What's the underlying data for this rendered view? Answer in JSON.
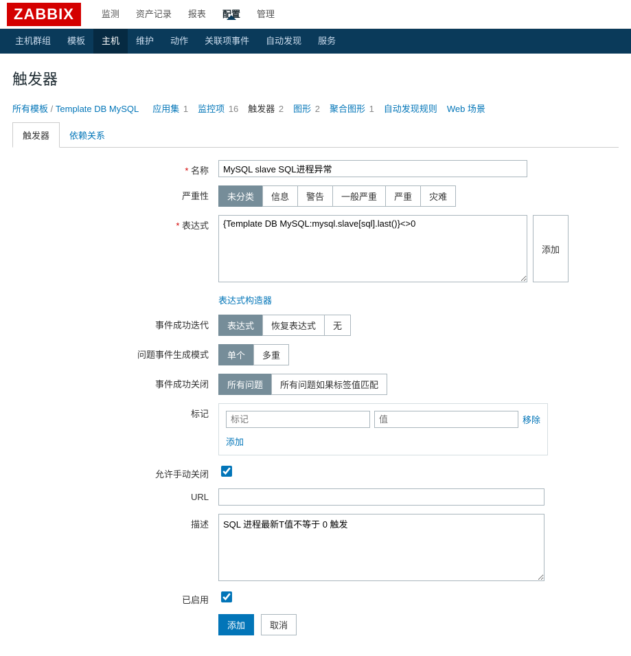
{
  "logo": "ZABBIX",
  "topnav": {
    "items": [
      {
        "label": "监测"
      },
      {
        "label": "资产记录"
      },
      {
        "label": "报表"
      },
      {
        "label": "配置"
      },
      {
        "label": "管理"
      }
    ],
    "activeIndex": 3
  },
  "subnav": {
    "items": [
      {
        "label": "主机群组"
      },
      {
        "label": "模板"
      },
      {
        "label": "主机"
      },
      {
        "label": "维护"
      },
      {
        "label": "动作"
      },
      {
        "label": "关联项事件"
      },
      {
        "label": "自动发现"
      },
      {
        "label": "服务"
      }
    ],
    "activeIndex": 2
  },
  "page_title": "触发器",
  "breadcrumb": {
    "root": "所有模板",
    "template": "Template DB MySQL",
    "tabs": [
      {
        "label": "应用集",
        "count": "1"
      },
      {
        "label": "监控项",
        "count": "16"
      },
      {
        "label": "触发器",
        "count": "2"
      },
      {
        "label": "图形",
        "count": "2"
      },
      {
        "label": "聚合图形",
        "count": "1"
      },
      {
        "label": "自动发现规则",
        "count": ""
      },
      {
        "label": "Web 场景",
        "count": ""
      }
    ],
    "activeIndex": 2
  },
  "formTabs": {
    "items": [
      {
        "label": "触发器"
      },
      {
        "label": "依赖关系"
      }
    ],
    "activeIndex": 0
  },
  "labels": {
    "name": "名称",
    "severity": "严重性",
    "expression": "表达式",
    "exprBuilder": "表达式构造器",
    "eventOkGen": "事件成功迭代",
    "problemEvtGen": "问题事件生成模式",
    "okEvtClose": "事件成功关闭",
    "tags": "标记",
    "tagAdd": "添加",
    "tagRemove": "移除",
    "tagNamePh": "标记",
    "tagValPh": "值",
    "allowManual": "允许手动关闭",
    "url": "URL",
    "description": "描述",
    "enabled": "已启用",
    "addBtn": "添加",
    "addSideBtn": "添加",
    "cancelBtn": "取消"
  },
  "values": {
    "name": "MySQL slave SQL进程异常",
    "expression": "{Template DB MySQL:mysql.slave[sql].last()}<>0",
    "url": "",
    "description": "SQL 进程最新T值不等于 0 触发",
    "allowManual": true,
    "enabled": true
  },
  "severity": {
    "options": [
      "未分类",
      "信息",
      "警告",
      "一般严重",
      "严重",
      "灾难"
    ],
    "selected": 0
  },
  "eventOkGen": {
    "options": [
      "表达式",
      "恢复表达式",
      "无"
    ],
    "selected": 0
  },
  "problemEvtGen": {
    "options": [
      "单个",
      "多重"
    ],
    "selected": 0
  },
  "okEvtClose": {
    "options": [
      "所有问题",
      "所有问题如果标签值匹配"
    ],
    "selected": 0
  }
}
